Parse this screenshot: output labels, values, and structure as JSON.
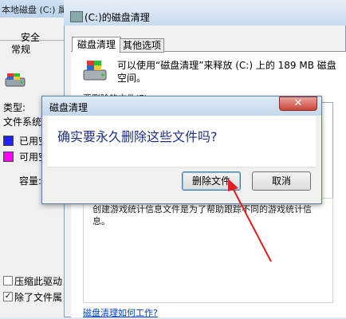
{
  "props": {
    "title": "本地磁盘 (C:) 属性",
    "tab_security": "安全",
    "tab_general": "常规",
    "type_label": "类型:",
    "fs_label": "文件系统:",
    "used_label": "已用空",
    "free_label": "可用空",
    "capacity_label": "容量:",
    "compress_label": "压缩此驱动",
    "index_label": "除了文件属",
    "used_color": "#2020ff",
    "free_color": "#ff00ff"
  },
  "cleanup": {
    "title": "(C:)的磁盘清理",
    "tab_cleanup": "磁盘清理",
    "tab_more": "其他选项",
    "info": "可以使用“磁盘清理”来释放 (C:) 上的 189 MB 磁盘空间。",
    "files_header": "要删除的文件(F):",
    "description": "创建游戏统计信息文件是为了帮助跟踪不同的游戏统计信息。",
    "help_link": "磁盘清理如何工作?"
  },
  "confirm": {
    "title": "磁盘清理",
    "close_glyph": "✕",
    "message": "确实要永久删除这些文件吗?",
    "delete_label": "删除文件",
    "cancel_label": "取消"
  }
}
